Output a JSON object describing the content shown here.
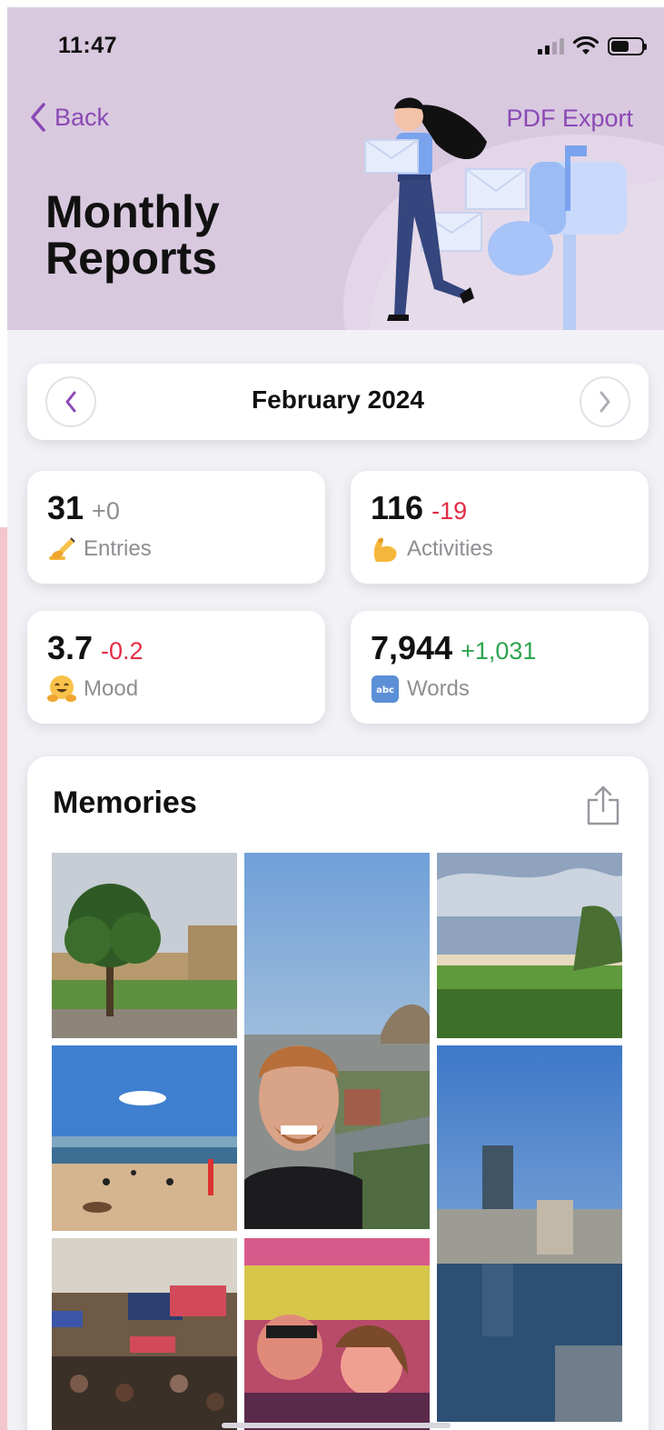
{
  "status_bar": {
    "time": "11:47"
  },
  "header": {
    "back_label": "Back",
    "export_label": "PDF Export",
    "title": "Monthly Reports"
  },
  "month_selector": {
    "label": "February 2024"
  },
  "stats": [
    {
      "value": "31",
      "delta": "+0",
      "label": "Entries",
      "emoji": "writing-hand-icon"
    },
    {
      "value": "116",
      "delta": "-19",
      "label": "Activities",
      "emoji": "flexed-biceps-icon"
    },
    {
      "value": "3.7",
      "delta": "-0.2",
      "label": "Mood",
      "emoji": "hugging-face-icon"
    },
    {
      "value": "7,944",
      "delta": "+1,031",
      "label": "Words",
      "emoji": "abc-icon"
    }
  ],
  "memories": {
    "title": "Memories",
    "photos": [
      "tree-on-campus-lawn",
      "selfie-harbour-bridge",
      "coastal-park-view",
      "beach-with-people",
      "city-harbour-tower",
      "lecture-hall-screens",
      "concert-crowd-selfie"
    ]
  },
  "colors": {
    "accent": "#8b49b5",
    "header_bg": "#d9c9df",
    "negative": "#e32d45",
    "positive": "#2ea44f",
    "neutral": "#8e8e93",
    "page_bg": "#f2f1f6"
  }
}
